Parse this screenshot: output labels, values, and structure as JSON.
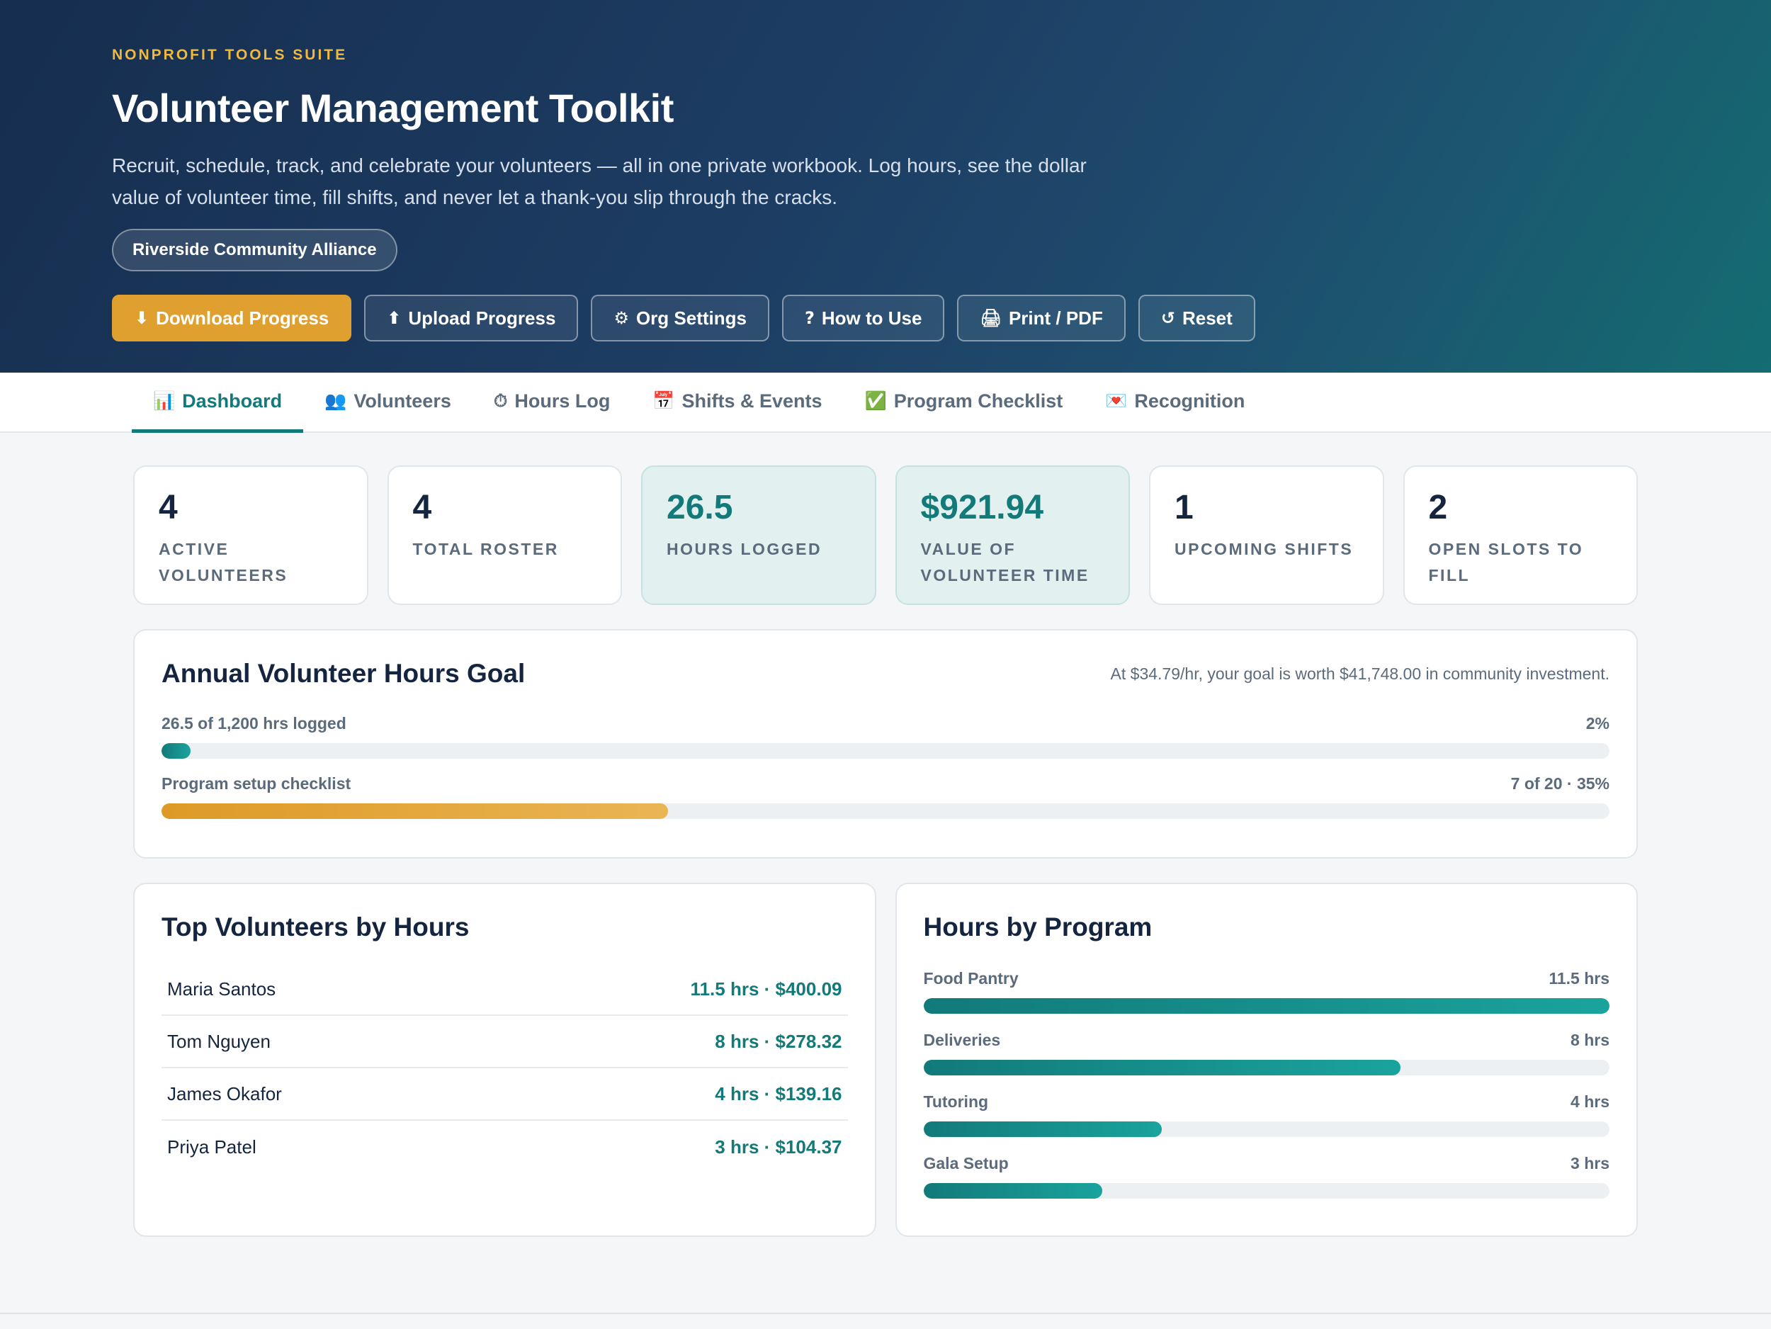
{
  "header": {
    "eyebrow": "NONPROFIT TOOLS SUITE",
    "title": "Volunteer Management Toolkit",
    "description": "Recruit, schedule, track, and celebrate your volunteers — all in one private workbook. Log hours, see the dollar value of volunteer time, fill shifts, and never let a thank-you slip through the cracks.",
    "org_name": "Riverside Community Alliance",
    "buttons": [
      {
        "icon": "⬇",
        "label": "Download Progress"
      },
      {
        "icon": "⬆",
        "label": "Upload Progress"
      },
      {
        "icon": "⚙",
        "label": "Org Settings"
      },
      {
        "icon": "?",
        "label": "How to Use"
      },
      {
        "icon": "🖨",
        "label": "Print / PDF"
      },
      {
        "icon": "↺",
        "label": "Reset"
      }
    ]
  },
  "tabs": [
    {
      "icon": "📊",
      "label": "Dashboard",
      "active": true
    },
    {
      "icon": "👥",
      "label": "Volunteers"
    },
    {
      "icon": "⏱",
      "label": "Hours Log"
    },
    {
      "icon": "📅",
      "label": "Shifts & Events"
    },
    {
      "icon": "✅",
      "label": "Program Checklist"
    },
    {
      "icon": "💌",
      "label": "Recognition"
    }
  ],
  "stats": [
    {
      "value": "4",
      "label": "Active Volunteers"
    },
    {
      "value": "4",
      "label": "Total Roster"
    },
    {
      "value": "26.5",
      "label": "Hours Logged"
    },
    {
      "value": "$921.94",
      "label": "Value of Volunteer Time"
    },
    {
      "value": "1",
      "label": "Upcoming Shifts"
    },
    {
      "value": "2",
      "label": "Open Slots to Fill"
    }
  ],
  "goal": {
    "title": "Annual Volunteer Hours Goal",
    "note": "At $34.79/hr, your goal is worth $41,748.00 in community investment.",
    "hours_label": "26.5 of 1,200 hrs logged",
    "hours_pct_text": "2%",
    "hours_fraction": 0.02,
    "checklist_label": "Program setup checklist",
    "checklist_text": "7 of 20 · 35%",
    "checklist_fraction": 0.35
  },
  "top_volunteers": {
    "title": "Top Volunteers by Hours",
    "rows": [
      {
        "name": "Maria Santos",
        "value": "11.5 hrs · $400.09"
      },
      {
        "name": "Tom Nguyen",
        "value": "8 hrs · $278.32"
      },
      {
        "name": "James Okafor",
        "value": "4 hrs · $139.16"
      },
      {
        "name": "Priya Patel",
        "value": "3 hrs · $104.37"
      }
    ]
  },
  "hours_by_program": {
    "title": "Hours by Program",
    "max_hours": 11.5,
    "rows": [
      {
        "name": "Food Pantry",
        "hours": 11.5,
        "label": "11.5 hrs"
      },
      {
        "name": "Deliveries",
        "hours": 8,
        "label": "8 hrs"
      },
      {
        "name": "Tutoring",
        "hours": 4,
        "label": "4 hrs"
      },
      {
        "name": "Gala Setup",
        "hours": 3,
        "label": "3 hrs"
      }
    ]
  },
  "colors": {
    "accent_teal": "#137a7a",
    "accent_gold": "#e0a02f",
    "header_dark": "#162e4f"
  }
}
